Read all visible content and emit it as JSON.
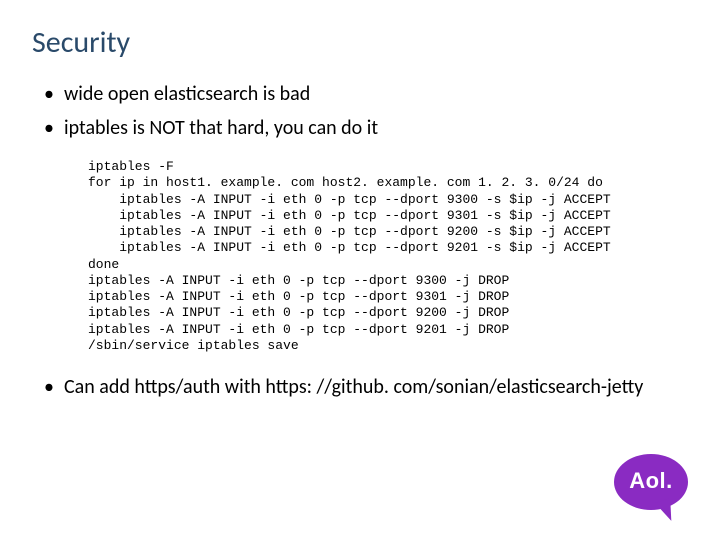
{
  "title": "Security",
  "bullets": {
    "b1": "wide open elasticsearch is bad",
    "b2": "iptables is NOT that hard, you can do it",
    "b3": "Can add https/auth with https: //github. com/sonian/elasticsearch-jetty"
  },
  "code": "iptables -F\nfor ip in host1. example. com host2. example. com 1. 2. 3. 0/24 do\n    iptables -A INPUT -i eth 0 -p tcp --dport 9300 -s $ip -j ACCEPT\n    iptables -A INPUT -i eth 0 -p tcp --dport 9301 -s $ip -j ACCEPT\n    iptables -A INPUT -i eth 0 -p tcp --dport 9200 -s $ip -j ACCEPT\n    iptables -A INPUT -i eth 0 -p tcp --dport 9201 -s $ip -j ACCEPT\ndone\niptables -A INPUT -i eth 0 -p tcp --dport 9300 -j DROP\niptables -A INPUT -i eth 0 -p tcp --dport 9301 -j DROP\niptables -A INPUT -i eth 0 -p tcp --dport 9200 -j DROP\niptables -A INPUT -i eth 0 -p tcp --dport 9201 -j DROP\n/sbin/service iptables save",
  "logo": {
    "text": "Aol."
  }
}
